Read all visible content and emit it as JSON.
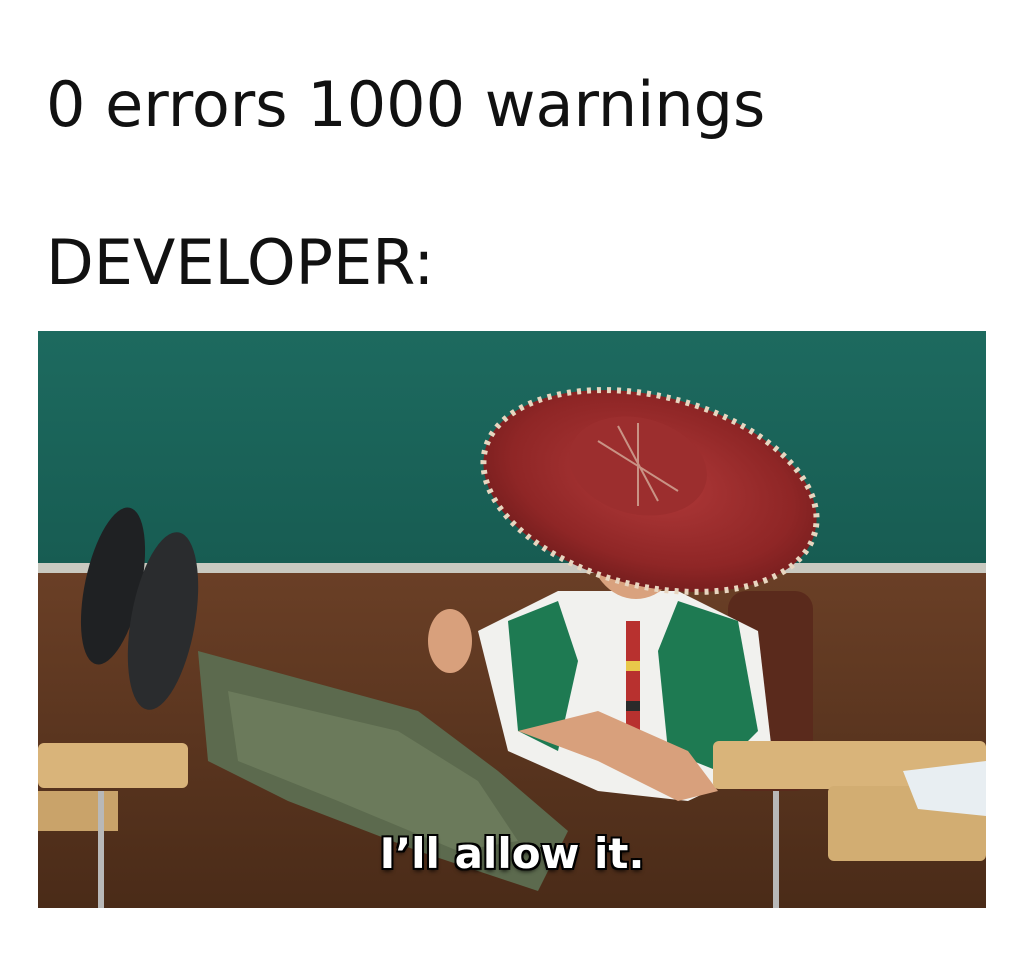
{
  "meme": {
    "line1": "0 errors 1000 warnings",
    "line2": "DEVELOPER:",
    "subtitle": "I’ll allow it."
  },
  "scene": {
    "chalkboard_color": "#1f6a5e",
    "wall_color": "#5e3823",
    "desk_color": "#d9b47a"
  }
}
